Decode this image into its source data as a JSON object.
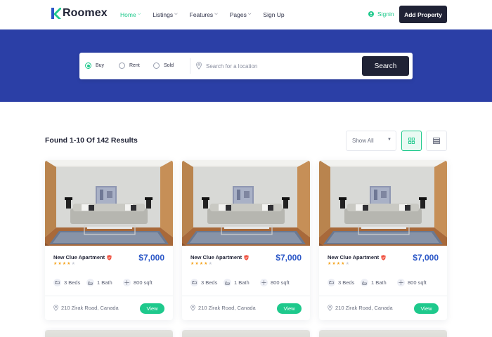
{
  "brand": {
    "name": "Roomex",
    "accent": "#1ec98c",
    "dark": "#1f2235",
    "hero_bg": "#2b3fa6",
    "price_color": "#2b57c7"
  },
  "nav": {
    "items": [
      {
        "label": "Home",
        "active": true,
        "has_caret": true
      },
      {
        "label": "Listings",
        "active": false,
        "has_caret": true
      },
      {
        "label": "Features",
        "active": false,
        "has_caret": true
      },
      {
        "label": "Pages",
        "active": false,
        "has_caret": true
      },
      {
        "label": "Sign Up",
        "active": false,
        "has_caret": false
      }
    ],
    "signin_label": "Signin",
    "add_property_label": "Add Property"
  },
  "search": {
    "options": [
      {
        "label": "Buy",
        "checked": true
      },
      {
        "label": "Rent",
        "checked": false
      },
      {
        "label": "Sold",
        "checked": false
      }
    ],
    "placeholder": "Search for a location",
    "value": "",
    "button_label": "Search"
  },
  "results": {
    "found_text": "Found 1-10 Of 142 Results",
    "filter_selected": "Show All",
    "view_mode": "grid"
  },
  "listings": [
    {
      "title": "New Clue Apartment",
      "rating": 4,
      "price": "$7,000",
      "beds": "3 Beds",
      "baths": "1 Bath",
      "area": "800 sqft",
      "address": "210 Zirak Road, Canada",
      "action": "View"
    },
    {
      "title": "New Clue Apartment",
      "rating": 4,
      "price": "$7,000",
      "beds": "3 Beds",
      "baths": "1 Bath",
      "area": "800 sqft",
      "address": "210 Zirak Road, Canada",
      "action": "View"
    },
    {
      "title": "New Clue Apartment",
      "rating": 4,
      "price": "$7,000",
      "beds": "3 Beds",
      "baths": "1 Bath",
      "area": "800 sqft",
      "address": "210 Zirak Road, Canada",
      "action": "View"
    }
  ]
}
